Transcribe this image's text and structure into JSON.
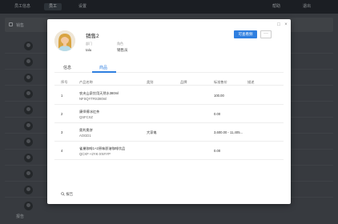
{
  "app": {
    "top_tabs": [
      "员工信息",
      "员工",
      "设置"
    ],
    "top_right": [
      "帮助",
      "退出"
    ],
    "toolbar_label": "销售",
    "footer_label": "报告"
  },
  "modal": {
    "controls": {
      "expand": "□",
      "close": "×"
    },
    "profile": {
      "name": "销售2",
      "fields": [
        {
          "label": "部门",
          "value": "talu"
        },
        {
          "label": "角色",
          "value": "销售员"
        }
      ]
    },
    "actions": {
      "primary": "可查看频",
      "more": "···"
    },
    "tabs": [
      {
        "label": "信息",
        "active": false
      },
      {
        "label": "商品",
        "active": true
      }
    ],
    "table": {
      "columns": [
        "序号",
        "产品名称",
        "类别",
        "品牌",
        "标准售价",
        "描述"
      ],
      "rows": [
        {
          "no": "1",
          "name": "农夫山泉饮用天然水380ml",
          "code": "NFSQYTRS380ml",
          "category": "",
          "brand": "",
          "price": "100.00",
          "desc": ""
        },
        {
          "no": "2",
          "name": "康师傅冰红茶",
          "code": "QSFCXZ",
          "category": "",
          "brand": "",
          "price": "0.00",
          "desc": ""
        },
        {
          "no": "3",
          "name": "奥利奥饼",
          "code": "AOGD1",
          "category": "大家电",
          "brand": "",
          "price": "3,600.00 - 11,405...",
          "desc": ""
        },
        {
          "no": "4",
          "name": "雀巢咖啡1+2原味即溶咖啡饮品",
          "code": "QCXF-+2YK-XNYYP",
          "category": "",
          "brand": "",
          "price": "0.00",
          "desc": ""
        }
      ]
    },
    "footer": "报告"
  },
  "colors": {
    "accent": "#2f7fe0",
    "topbar": "#1f2328"
  }
}
